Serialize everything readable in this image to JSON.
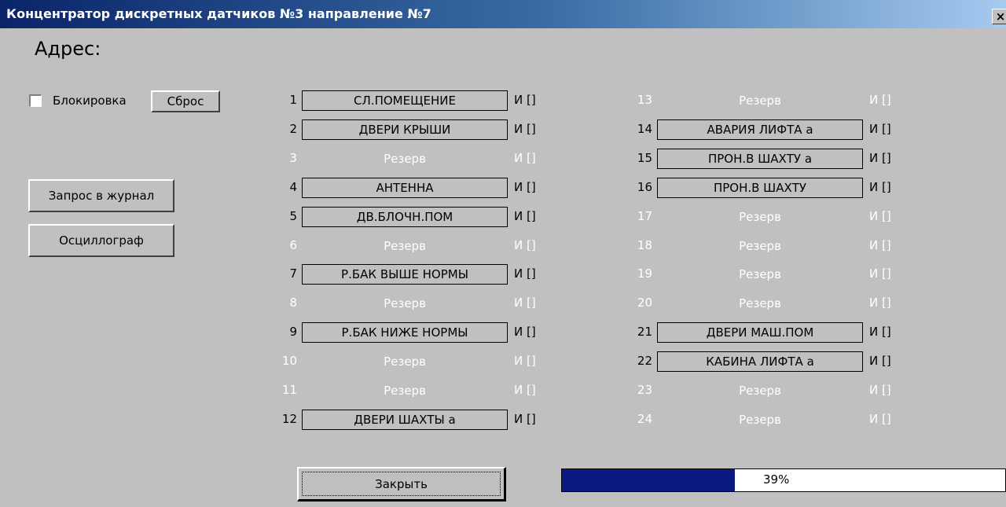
{
  "window": {
    "title": "Концентратор дискретных датчиков №3 направление №7",
    "close_glyph": "×"
  },
  "address_label": "Адрес:",
  "lock": {
    "label": "Блокировка",
    "checked": false
  },
  "buttons": {
    "reset": "Сброс",
    "log_request": "Запрос в журнал",
    "oscillograph": "Осциллограф",
    "close": "Закрыть"
  },
  "progress": {
    "value": 0.39,
    "label": "39%"
  },
  "sensors": [
    {
      "num": "1",
      "name": "СЛ.ПОМЕЩЕНИЕ",
      "state": "И []",
      "reserve": false
    },
    {
      "num": "2",
      "name": "ДВЕРИ КРЫШИ",
      "state": "И []",
      "reserve": false
    },
    {
      "num": "3",
      "name": "Резерв",
      "state": "И []",
      "reserve": true
    },
    {
      "num": "4",
      "name": "АНТЕННА",
      "state": "И []",
      "reserve": false
    },
    {
      "num": "5",
      "name": "ДВ.БЛОЧН.ПОМ",
      "state": "И []",
      "reserve": false
    },
    {
      "num": "6",
      "name": "Резерв",
      "state": "И []",
      "reserve": true
    },
    {
      "num": "7",
      "name": "Р.БАК ВЫШЕ НОРМЫ",
      "state": "И []",
      "reserve": false
    },
    {
      "num": "8",
      "name": "Резерв",
      "state": "И []",
      "reserve": true
    },
    {
      "num": "9",
      "name": "Р.БАК НИЖЕ НОРМЫ",
      "state": "И []",
      "reserve": false
    },
    {
      "num": "10",
      "name": "Резерв",
      "state": "И []",
      "reserve": true
    },
    {
      "num": "11",
      "name": "Резерв",
      "state": "И []",
      "reserve": true
    },
    {
      "num": "12",
      "name": "ДВЕРИ ШАХТЫ а",
      "state": "И []",
      "reserve": false
    },
    {
      "num": "13",
      "name": "Резерв",
      "state": "И []",
      "reserve": true
    },
    {
      "num": "14",
      "name": "АВАРИЯ ЛИФТА а",
      "state": "И []",
      "reserve": false
    },
    {
      "num": "15",
      "name": "ПРОН.В ШАХТУ а",
      "state": "И []",
      "reserve": false
    },
    {
      "num": "16",
      "name": "ПРОН.В ШАХТУ",
      "state": "И []",
      "reserve": false
    },
    {
      "num": "17",
      "name": "Резерв",
      "state": "И []",
      "reserve": true
    },
    {
      "num": "18",
      "name": "Резерв",
      "state": "И []",
      "reserve": true
    },
    {
      "num": "19",
      "name": "Резерв",
      "state": "И []",
      "reserve": true
    },
    {
      "num": "20",
      "name": "Резерв",
      "state": "И []",
      "reserve": true
    },
    {
      "num": "21",
      "name": "ДВЕРИ МАШ.ПОМ",
      "state": "И []",
      "reserve": false
    },
    {
      "num": "22",
      "name": "КАБИНА ЛИФТА а",
      "state": "И []",
      "reserve": false
    },
    {
      "num": "23",
      "name": "Резерв",
      "state": "И []",
      "reserve": true
    },
    {
      "num": "24",
      "name": "Резерв",
      "state": "И []",
      "reserve": true
    }
  ]
}
